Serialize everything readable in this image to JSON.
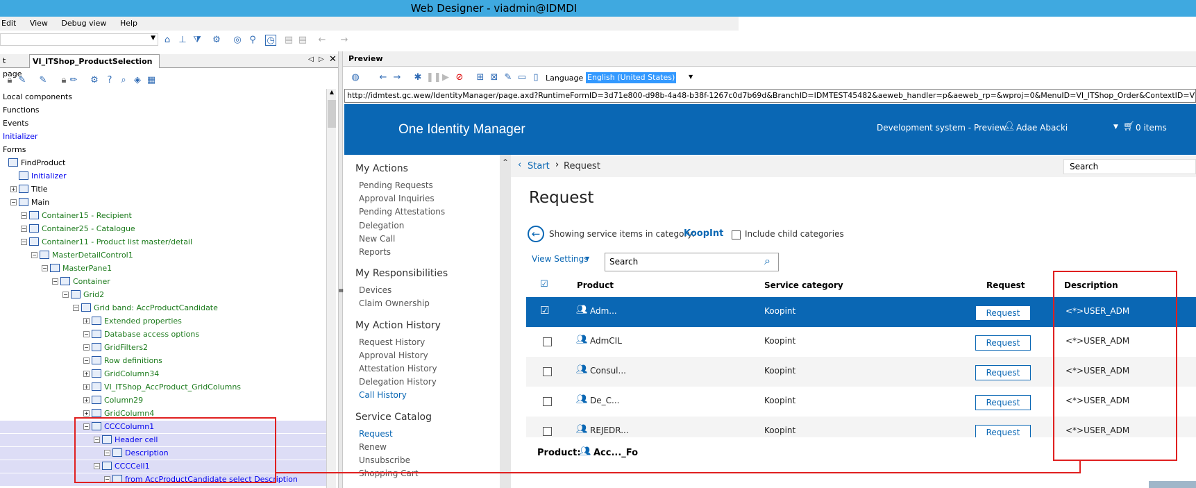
{
  "window": {
    "title": "Web Designer - viadmin@IDMDI"
  },
  "menu": {
    "items": [
      "Edit",
      "View",
      "Debug view",
      "Help"
    ]
  },
  "left_panel": {
    "tab_partial": "t page",
    "tab_active": "VI_ITShop_ProductSelection",
    "tree": [
      {
        "label": "Local components",
        "indent": 0,
        "style": "normal"
      },
      {
        "label": "Functions",
        "indent": 0,
        "style": "normal"
      },
      {
        "label": "Events",
        "indent": 0,
        "style": "normal"
      },
      {
        "label": "Initializer",
        "indent": 0,
        "style": "blue"
      },
      {
        "label": "Forms",
        "indent": 0,
        "style": "normal"
      },
      {
        "label": "FindProduct",
        "indent": 0,
        "style": "normal"
      },
      {
        "label": "Initializer",
        "indent": 1,
        "style": "blue"
      },
      {
        "label": "Title",
        "indent": 1,
        "style": "normal"
      },
      {
        "label": "Main",
        "indent": 1,
        "style": "normal"
      },
      {
        "label": "Container15 - Recipient",
        "indent": 2,
        "style": "green"
      },
      {
        "label": "Container25 - Catalogue",
        "indent": 2,
        "style": "green"
      },
      {
        "label": "Container11 - Product list master/detail",
        "indent": 2,
        "style": "green"
      },
      {
        "label": "MasterDetailControl1",
        "indent": 3,
        "style": "green"
      },
      {
        "label": "MasterPane1",
        "indent": 4,
        "style": "green"
      },
      {
        "label": "Container",
        "indent": 5,
        "style": "green"
      },
      {
        "label": "Grid2",
        "indent": 6,
        "style": "green"
      },
      {
        "label": "Grid band: AccProductCandidate",
        "indent": 7,
        "style": "green"
      },
      {
        "label": "Extended properties",
        "indent": 8,
        "style": "green"
      },
      {
        "label": "Database access options",
        "indent": 8,
        "style": "green"
      },
      {
        "label": "GridFilters2",
        "indent": 8,
        "style": "green"
      },
      {
        "label": "Row definitions",
        "indent": 8,
        "style": "green"
      },
      {
        "label": "GridColumn34",
        "indent": 8,
        "style": "green"
      },
      {
        "label": "VI_ITShop_AccProduct_GridColumns",
        "indent": 8,
        "style": "green"
      },
      {
        "label": "Column29",
        "indent": 8,
        "style": "green"
      },
      {
        "label": "GridColumn4",
        "indent": 8,
        "style": "green"
      },
      {
        "label": "CCCColumn1",
        "indent": 8,
        "style": "blue-hl"
      },
      {
        "label": "Header cell",
        "indent": 9,
        "style": "blue-hl"
      },
      {
        "label": "Description",
        "indent": 10,
        "style": "blue-hl"
      },
      {
        "label": "CCCCell1",
        "indent": 9,
        "style": "blue-hl"
      },
      {
        "label": "from AccProductCandidate select Description",
        "indent": 10,
        "style": "blue-hl"
      }
    ]
  },
  "preview": {
    "header": "Preview",
    "language_label": "Language",
    "language_value": "English (United States)",
    "url": "http://idmtest.gc.wew/IdentityManager/page.axd?RuntimeFormID=3d71e800-d98b-4a48-b38f-1267c0d7b69d&BranchID=IDMTEST45482&aeweb_handler=p&aeweb_rp=&wproj=0&MenuID=VI_ITShop_Order&ContextID=VI_ITShop_ProductSelection",
    "app_title": "One Identity Manager",
    "environment": "Development system - Preview",
    "user": "Adae Abacki",
    "cart": "0 items",
    "nav": {
      "sections": [
        {
          "title": "My Actions",
          "items": [
            "Pending Requests",
            "Approval Inquiries",
            "Pending Attestations",
            "Delegation",
            "New Call",
            "Reports"
          ]
        },
        {
          "title": "My Responsibilities",
          "items": [
            "Devices",
            "Claim Ownership"
          ]
        },
        {
          "title": "My Action History",
          "items": [
            "Request History",
            "Approval History",
            "Attestation History",
            "Delegation History",
            "Call History"
          ]
        },
        {
          "title": "Service Catalog",
          "items": [
            "Request",
            "Renew",
            "Unsubscribe",
            "Shopping Cart"
          ]
        }
      ]
    },
    "breadcrumb": {
      "start": "Start",
      "current": "Request"
    },
    "search_top": "Search",
    "page_title": "Request",
    "category_text": "Showing service items in category:",
    "category": "KoopInt",
    "include_child": "Include child categories",
    "view_settings": "View Settings",
    "search_placeholder": "Search",
    "columns": [
      "Product",
      "Service category",
      "Request",
      "Description"
    ],
    "rows": [
      {
        "product": "Adm...",
        "category": "Koopint",
        "button": "Request",
        "description": "<*>USER_ADM",
        "selected": true
      },
      {
        "product": "AdmCIL",
        "category": "Koopint",
        "button": "Request",
        "description": "<*>USER_ADM",
        "selected": false
      },
      {
        "product": "Consul...",
        "category": "Koopint",
        "button": "Request",
        "description": "<*>USER_ADM",
        "selected": false
      },
      {
        "product": "De_C...",
        "category": "Koopint",
        "button": "Request",
        "description": "<*>USER_ADM",
        "selected": false
      },
      {
        "product": "REJEDR...",
        "category": "Koopint",
        "button": "Request",
        "description": "<*>USER_ADM",
        "selected": false
      }
    ],
    "detail_label": "Product:",
    "detail_value": "Acc..._Fo"
  },
  "colors": {
    "titlebar": "#3fa9e0",
    "brand": "#0a67b4",
    "highlight": "#e02020"
  }
}
